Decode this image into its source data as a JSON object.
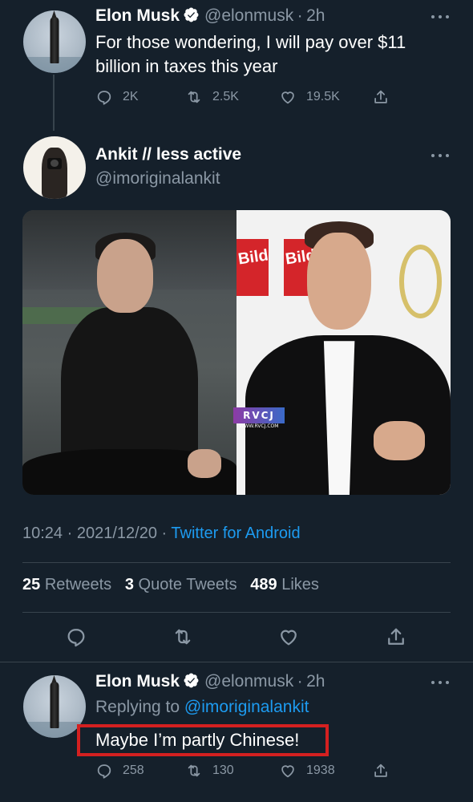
{
  "tweet1": {
    "name": "Elon Musk",
    "handle": "@elonmusk",
    "sep": "·",
    "time": "2h",
    "text_line1": "For those wondering, I will pay over $11",
    "text_line2": "billion in taxes this year",
    "replies": "2K",
    "retweets": "2.5K",
    "likes": "19.5K"
  },
  "tweet2": {
    "name": "Ankit // less active",
    "handle": "@imoriginalankit",
    "watermark": "RVCJ",
    "watermark_url": "WWW.RVCJ.COM",
    "bild_label_1": "Bild",
    "bild_label_2": "Bild",
    "time": "10:24",
    "date": "2021/12/20",
    "sep": "·",
    "source": "Twitter for Android",
    "retweets_count": "25",
    "retweets_label": "Retweets",
    "quotes_count": "3",
    "quotes_label": "Quote Tweets",
    "likes_count": "489",
    "likes_label": "Likes"
  },
  "reply": {
    "name": "Elon Musk",
    "handle": "@elonmusk",
    "sep": "·",
    "time": "2h",
    "replying_label": "Replying to",
    "replying_handle": "@imoriginalankit",
    "text": "Maybe I’m partly Chinese!",
    "replies": "258",
    "retweets": "130",
    "likes": "1938"
  },
  "colors": {
    "background": "#15202b",
    "link": "#1d9bf0",
    "muted": "#8b98a5",
    "highlight_box": "#d42020"
  },
  "icons": [
    "verified-badge-icon",
    "more-icon",
    "reply-icon",
    "retweet-icon",
    "like-icon",
    "share-icon"
  ]
}
